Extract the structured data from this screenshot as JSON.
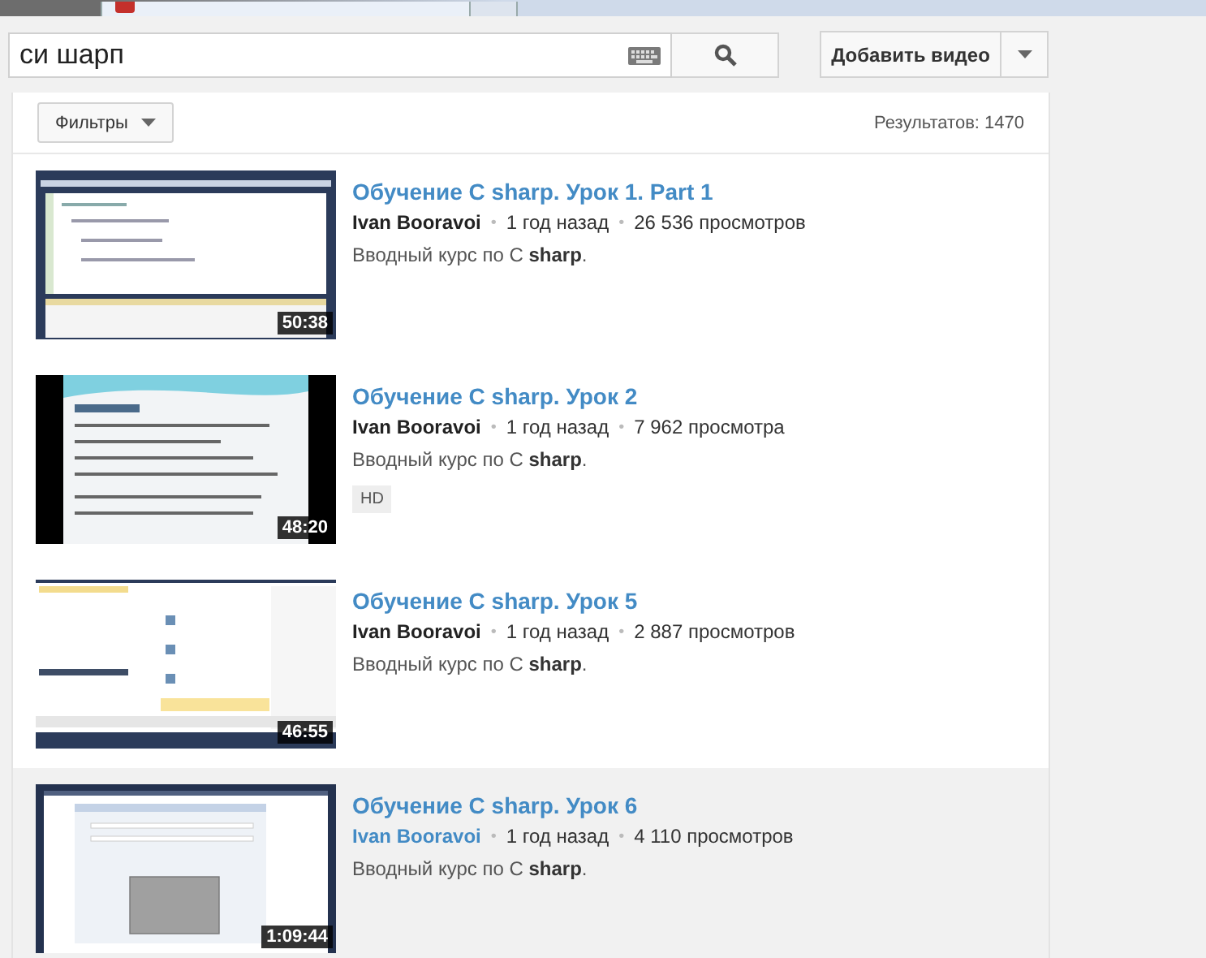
{
  "search": {
    "value": "си шарп"
  },
  "upload_button": {
    "label": "Добавить видео"
  },
  "filters_button": {
    "label": "Фильтры"
  },
  "results_count": "Результатов: 1470",
  "videos": [
    {
      "kind": "picture",
      "title": "Обучение C sharp. Урок 1. Part 1",
      "author": "Ivan Booravoi",
      "separators": [
        "•",
        "•"
      ],
      "age": "1 год назад",
      "views": "26 536 просмотров",
      "description": "Вводный курс по C **sharp**.",
      "duration": "50:38",
      "highlighted": false
    },
    {
      "kind": "picture",
      "title": "Обучение C sharp. Урок 2",
      "author": "Ivan Booravoi",
      "separators": [
        "•",
        "•"
      ],
      "age": "1 год назад",
      "views": "7 962 просмотра",
      "description": "Вводный курс по C **sharp**.",
      "badge": "HD",
      "duration": "48:20",
      "highlighted": false
    },
    {
      "kind": "picture",
      "title": "Обучение C sharp. Урок 5",
      "author": "Ivan Booravoi",
      "separators": [
        "•",
        "•"
      ],
      "age": "1 год назад",
      "views": "2 887 просмотров",
      "description": "Вводный курс по C **sharp**.",
      "duration": "46:55",
      "highlighted": false
    },
    {
      "kind": "picture",
      "title": "Обучение C sharp. Урок 6",
      "author": "Ivan Booravoi",
      "separators": [
        "•",
        "•"
      ],
      "age": "1 год назад",
      "views": "4 110 просмотров",
      "description": "Вводный курс по C **sharp**.",
      "duration": "1:09:44",
      "highlighted": true
    }
  ]
}
